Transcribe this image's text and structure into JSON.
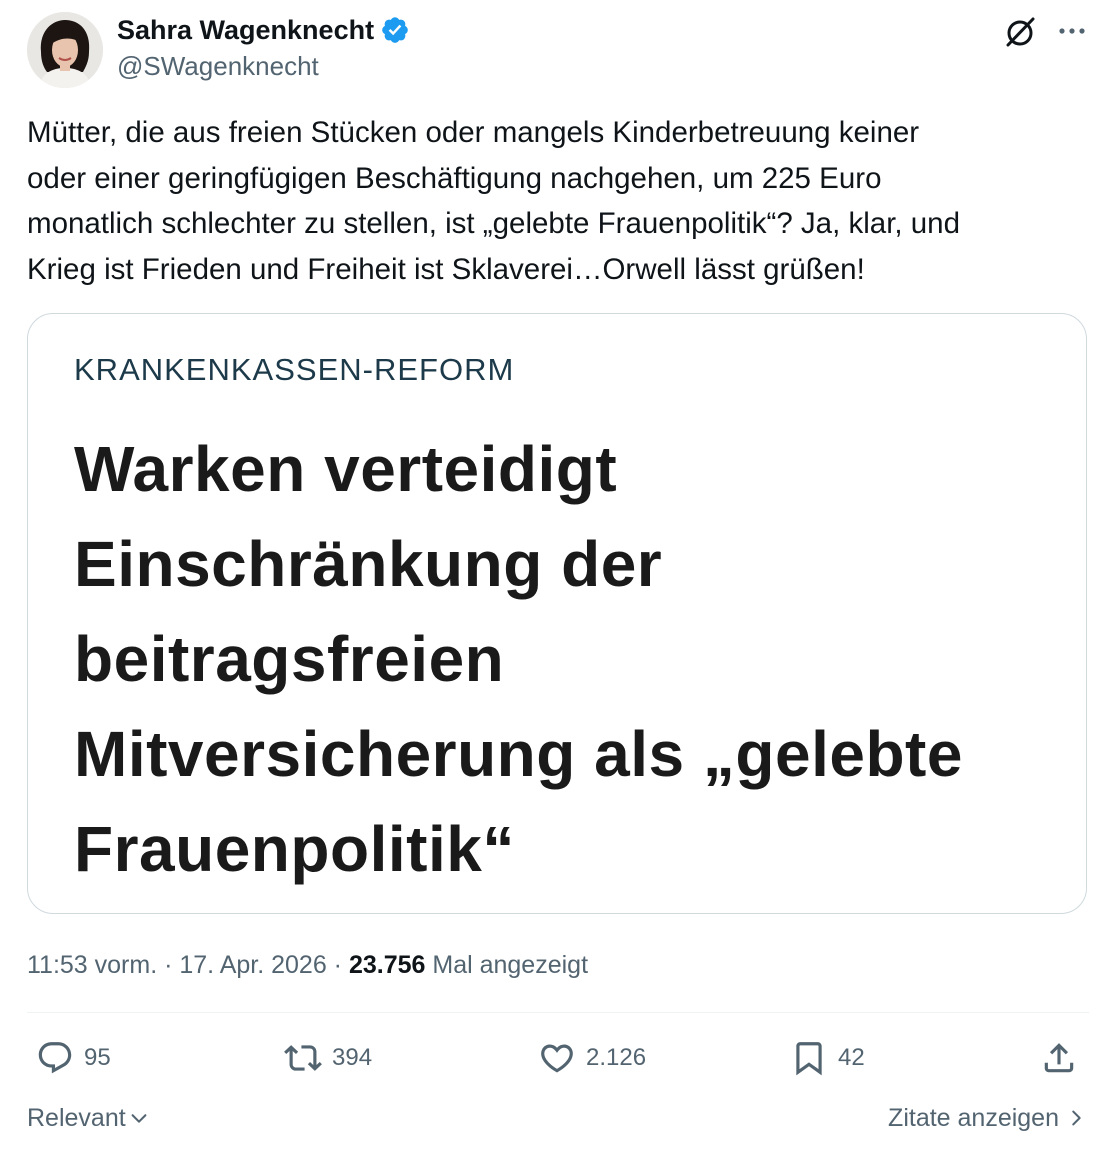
{
  "author": {
    "display_name": "Sahra Wagenknecht",
    "handle": "@SWagenknecht",
    "verified": true,
    "verified_color": "#1d9bf0"
  },
  "tweet": {
    "text": "Mütter, die aus freien Stücken oder mangels Kinderbetreuung keiner\noder einer geringfügigen Beschäftigung nachgehen, um 225 Euro\nmonatlich schlechter zu stellen, ist „gelebte Frauenpolitik“? Ja, klar, und\nKrieg ist Frieden und Freiheit ist Sklaverei…Orwell lässt grüßen!"
  },
  "media": {
    "kicker": "KRANKENKASSEN-REFORM",
    "headline": "Warken verteidigt\nEinschränkung der\nbeitragsfreien\nMitversicherung als „gelebte\nFrauenpolitik“"
  },
  "meta": {
    "time": "11:53 vorm.",
    "separator_1": " · ",
    "date": "17. Apr. 2026",
    "separator_2": " · ",
    "views_count": "23.756",
    "views_label": " Mal angezeigt"
  },
  "actions": {
    "replies": "95",
    "reposts": "394",
    "likes": "2.126",
    "bookmarks": "42"
  },
  "footer": {
    "sort_label": "Relevant",
    "quotes_link": "Zitate anzeigen"
  },
  "icons": {
    "grok": "grok-icon",
    "more": "more-dots-icon",
    "reply": "reply-icon",
    "repost": "repost-icon",
    "like": "heart-icon",
    "bookmark": "bookmark-icon",
    "share": "share-icon"
  }
}
